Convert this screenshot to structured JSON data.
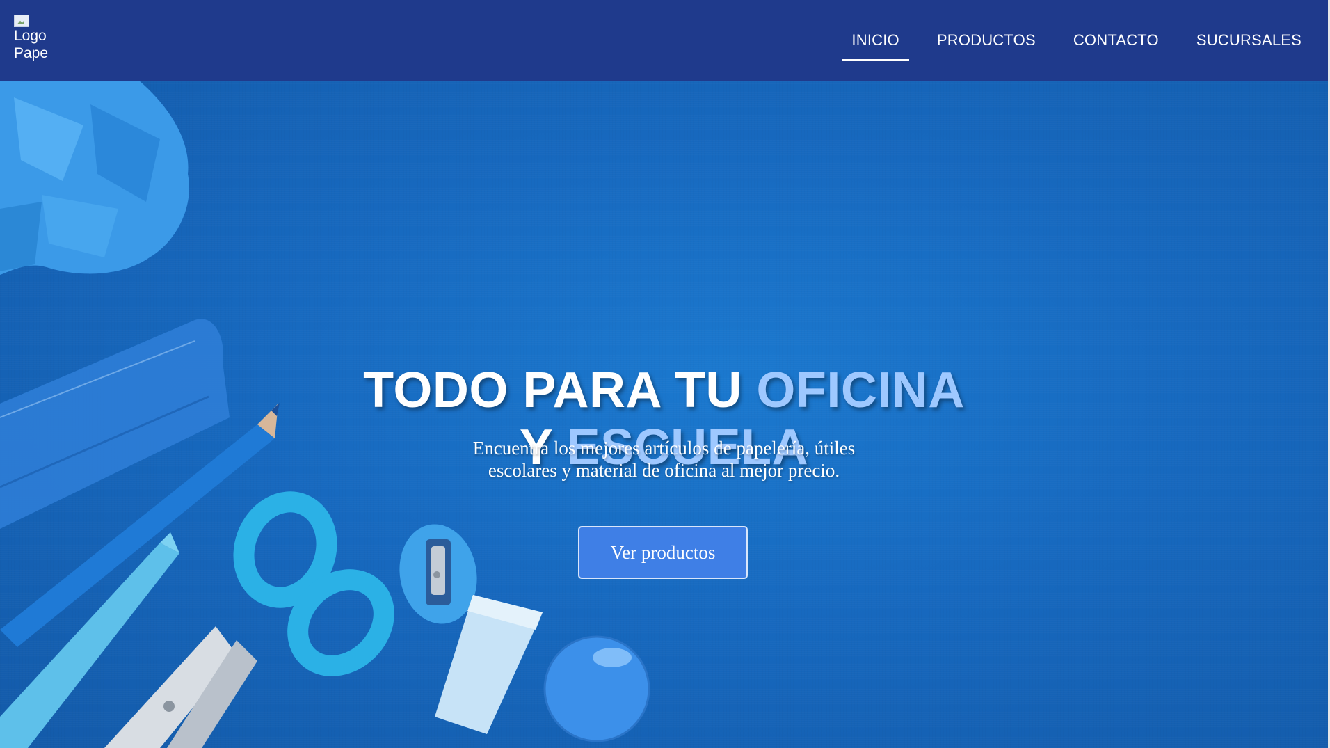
{
  "header": {
    "logo_alt_line1": "Logo",
    "logo_alt_line2": "Papel",
    "nav": [
      {
        "label": "INICIO",
        "active": true
      },
      {
        "label": "PRODUCTOS",
        "active": false
      },
      {
        "label": "CONTACTO",
        "active": false
      },
      {
        "label": "SUCURSALES",
        "active": false
      }
    ]
  },
  "hero": {
    "headline_part1": "TODO PARA TU ",
    "headline_accent1": "OFICINA",
    "headline_part2": "Y ",
    "headline_accent2": "ESCUELA",
    "subtitle_line1": "Encuentra los mejores artículos de papelería, útiles",
    "subtitle_line2": "escolares y material de oficina al mejor precio.",
    "cta_label": "Ver productos"
  },
  "colors": {
    "navbar": "#1f3a8c",
    "hero_background": "#1769bf",
    "accent_text": "#9ec8ff",
    "cta_button": "#3f7fe6"
  }
}
